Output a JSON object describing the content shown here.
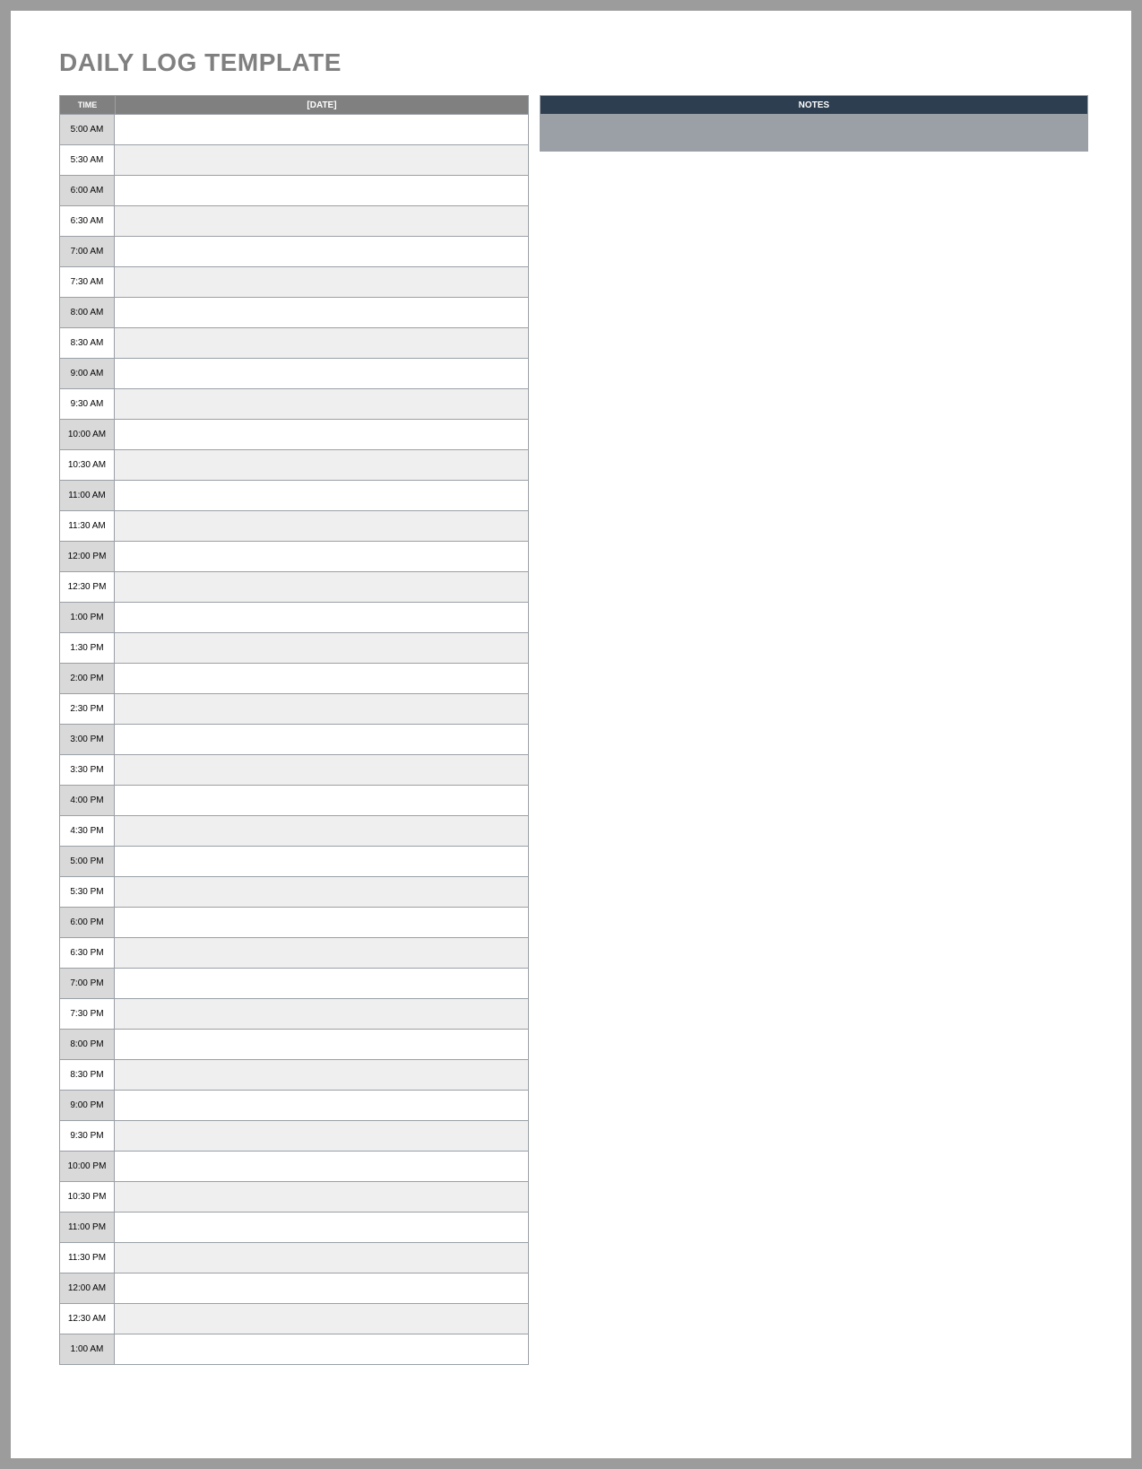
{
  "title": "DAILY LOG TEMPLATE",
  "headers": {
    "time": "TIME",
    "date": "[DATE]",
    "notes": "NOTES"
  },
  "rows": [
    {
      "time": "5:00 AM",
      "hour_shade": true,
      "row_shade": false
    },
    {
      "time": "5:30 AM",
      "hour_shade": false,
      "row_shade": true
    },
    {
      "time": "6:00 AM",
      "hour_shade": true,
      "row_shade": false
    },
    {
      "time": "6:30 AM",
      "hour_shade": false,
      "row_shade": true
    },
    {
      "time": "7:00 AM",
      "hour_shade": true,
      "row_shade": false
    },
    {
      "time": "7:30 AM",
      "hour_shade": false,
      "row_shade": true
    },
    {
      "time": "8:00 AM",
      "hour_shade": true,
      "row_shade": false
    },
    {
      "time": "8:30 AM",
      "hour_shade": false,
      "row_shade": true
    },
    {
      "time": "9:00 AM",
      "hour_shade": true,
      "row_shade": false
    },
    {
      "time": "9:30 AM",
      "hour_shade": false,
      "row_shade": true
    },
    {
      "time": "10:00 AM",
      "hour_shade": true,
      "row_shade": false
    },
    {
      "time": "10:30 AM",
      "hour_shade": false,
      "row_shade": true
    },
    {
      "time": "11:00 AM",
      "hour_shade": true,
      "row_shade": false
    },
    {
      "time": "11:30 AM",
      "hour_shade": false,
      "row_shade": true
    },
    {
      "time": "12:00 PM",
      "hour_shade": true,
      "row_shade": false
    },
    {
      "time": "12:30 PM",
      "hour_shade": false,
      "row_shade": true
    },
    {
      "time": "1:00 PM",
      "hour_shade": true,
      "row_shade": false
    },
    {
      "time": "1:30 PM",
      "hour_shade": false,
      "row_shade": true
    },
    {
      "time": "2:00 PM",
      "hour_shade": true,
      "row_shade": false
    },
    {
      "time": "2:30 PM",
      "hour_shade": false,
      "row_shade": true
    },
    {
      "time": "3:00 PM",
      "hour_shade": true,
      "row_shade": false
    },
    {
      "time": "3:30 PM",
      "hour_shade": false,
      "row_shade": true
    },
    {
      "time": "4:00 PM",
      "hour_shade": true,
      "row_shade": false
    },
    {
      "time": "4:30 PM",
      "hour_shade": false,
      "row_shade": true
    },
    {
      "time": "5:00 PM",
      "hour_shade": true,
      "row_shade": false
    },
    {
      "time": "5:30 PM",
      "hour_shade": false,
      "row_shade": true
    },
    {
      "time": "6:00 PM",
      "hour_shade": true,
      "row_shade": false
    },
    {
      "time": "6:30 PM",
      "hour_shade": false,
      "row_shade": true
    },
    {
      "time": "7:00 PM",
      "hour_shade": true,
      "row_shade": false
    },
    {
      "time": "7:30 PM",
      "hour_shade": false,
      "row_shade": true
    },
    {
      "time": "8:00 PM",
      "hour_shade": true,
      "row_shade": false
    },
    {
      "time": "8:30 PM",
      "hour_shade": false,
      "row_shade": true
    },
    {
      "time": "9:00 PM",
      "hour_shade": true,
      "row_shade": false
    },
    {
      "time": "9:30 PM",
      "hour_shade": false,
      "row_shade": true
    },
    {
      "time": "10:00 PM",
      "hour_shade": true,
      "row_shade": false
    },
    {
      "time": "10:30 PM",
      "hour_shade": false,
      "row_shade": true
    },
    {
      "time": "11:00 PM",
      "hour_shade": true,
      "row_shade": false
    },
    {
      "time": "11:30 PM",
      "hour_shade": false,
      "row_shade": true
    },
    {
      "time": "12:00 AM",
      "hour_shade": true,
      "row_shade": false
    },
    {
      "time": "12:30 AM",
      "hour_shade": false,
      "row_shade": true
    },
    {
      "time": "1:00 AM",
      "hour_shade": true,
      "row_shade": false
    }
  ]
}
